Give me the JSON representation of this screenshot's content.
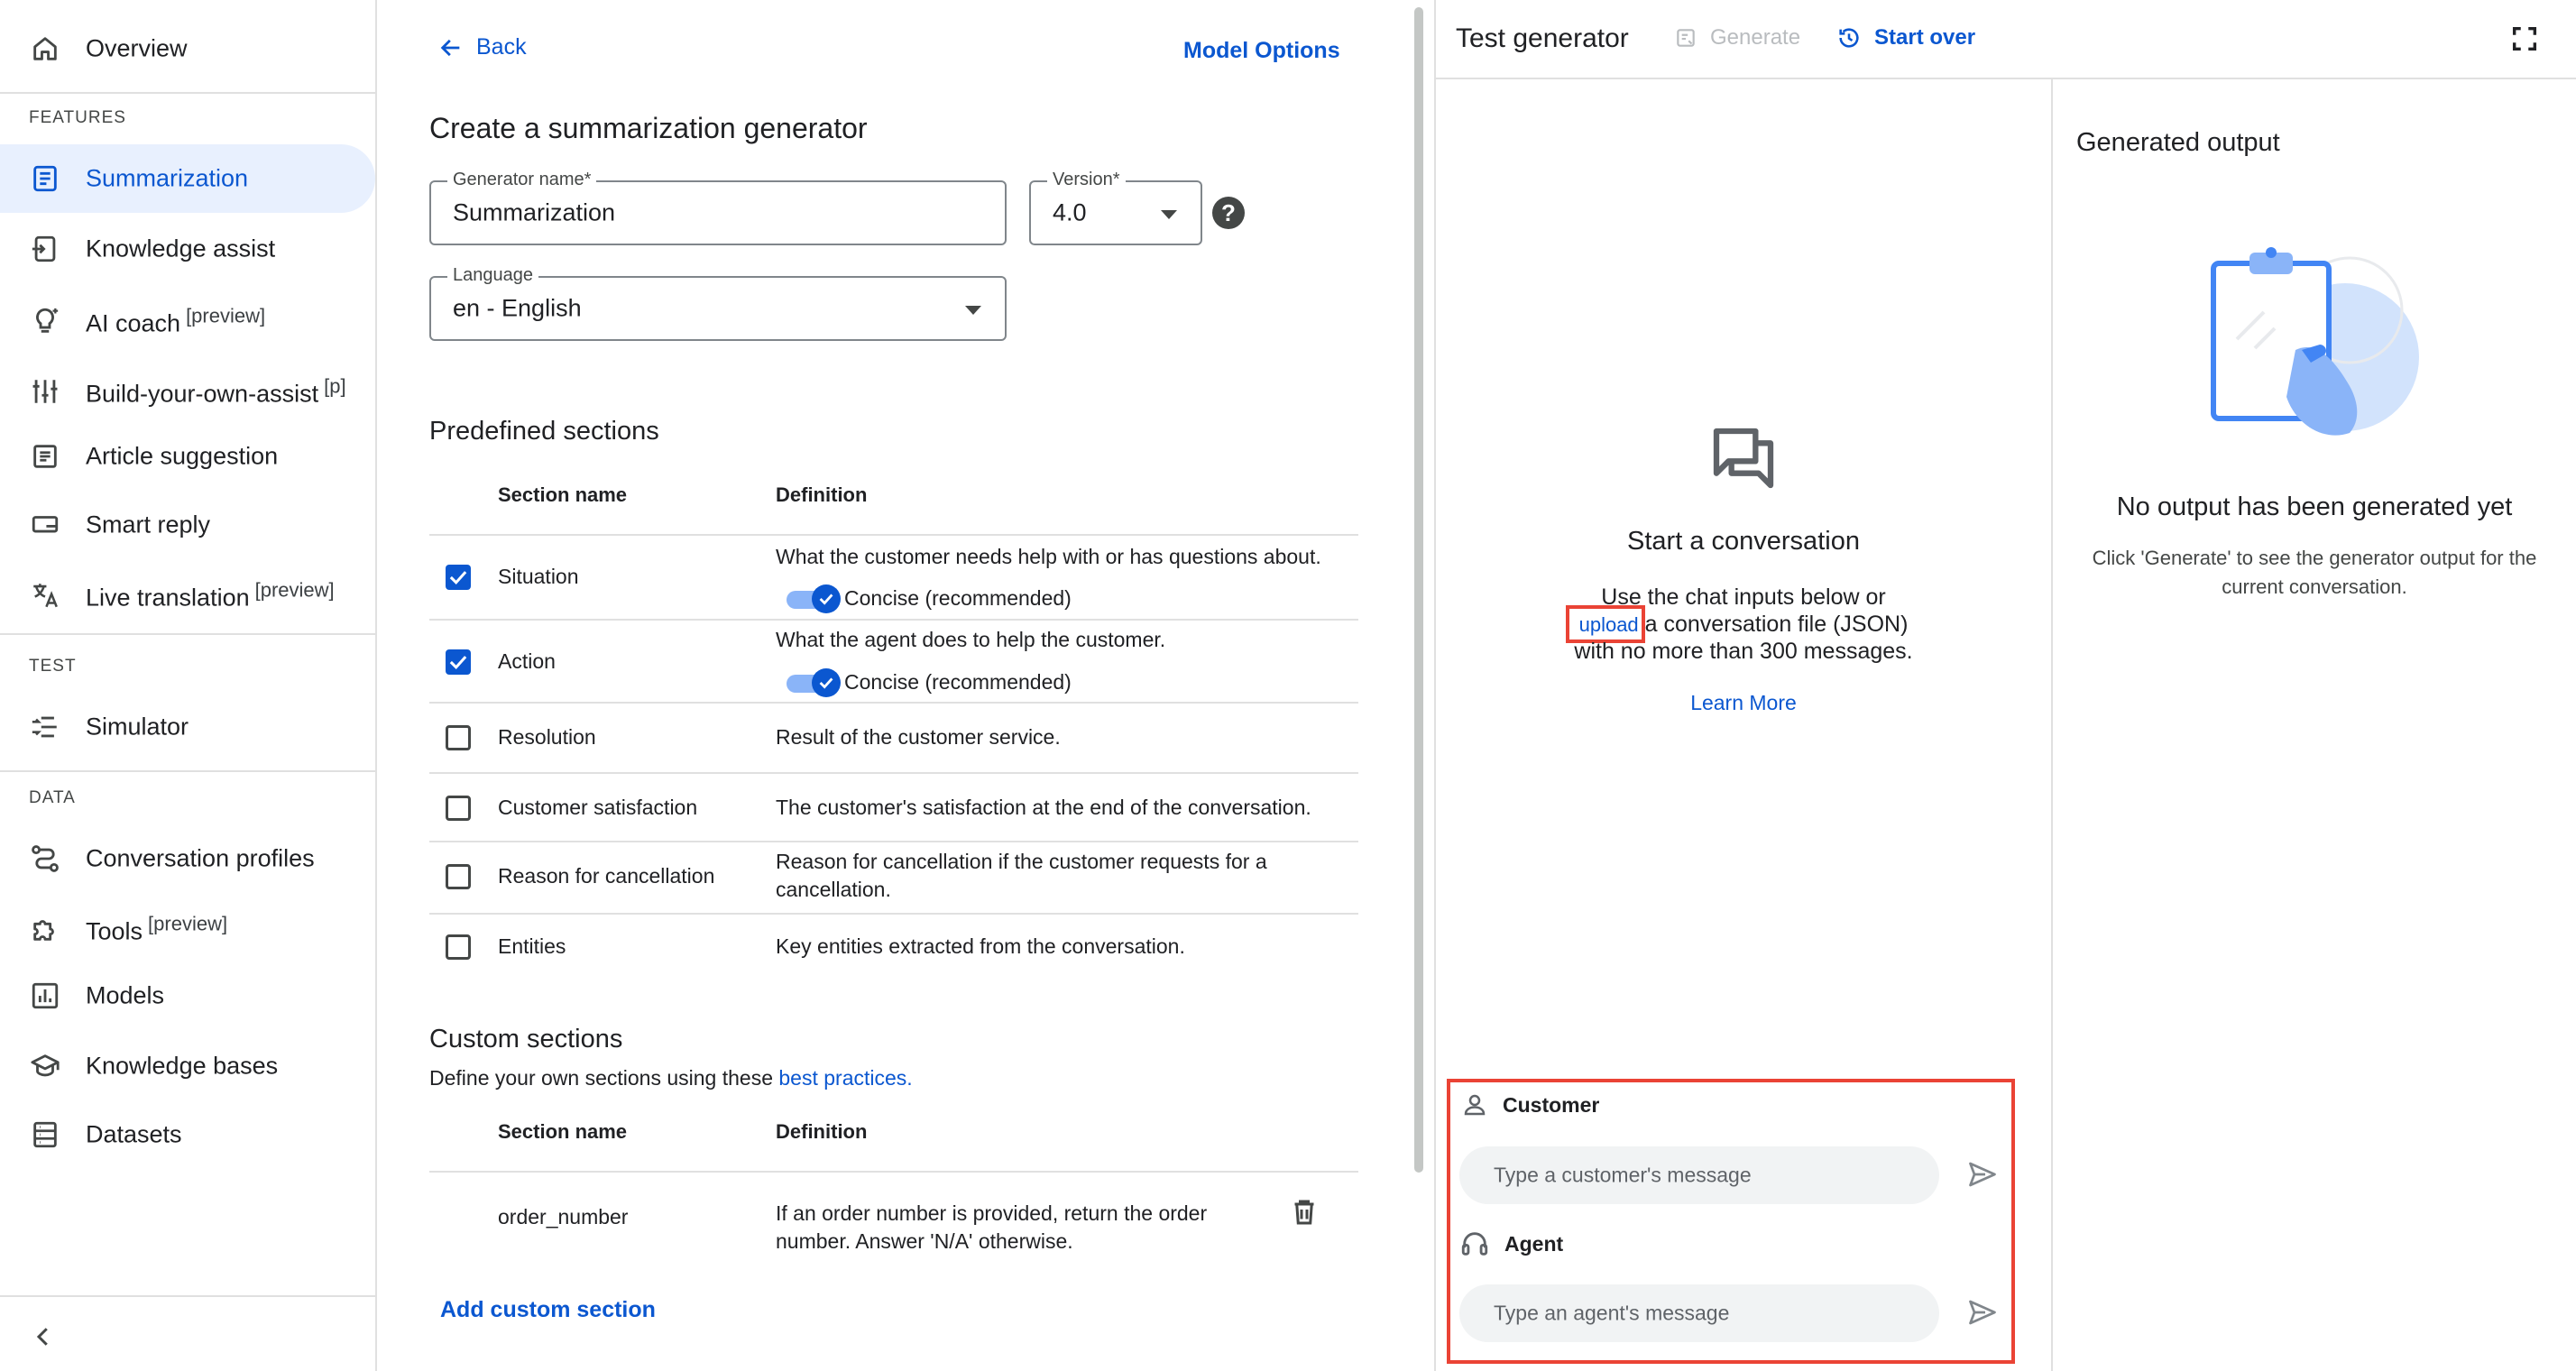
{
  "sidebar": {
    "overview": "Overview",
    "features_head": "FEATURES",
    "items": [
      {
        "label": "Summarization",
        "tag": ""
      },
      {
        "label": "Knowledge assist",
        "tag": ""
      },
      {
        "label": "AI coach",
        "tag": "[preview]"
      },
      {
        "label": "Build-your-own-assist",
        "tag": "[p]"
      },
      {
        "label": "Article suggestion",
        "tag": ""
      },
      {
        "label": "Smart reply",
        "tag": ""
      },
      {
        "label": "Live translation",
        "tag": "[preview]"
      }
    ],
    "test_head": "TEST",
    "simulator": "Simulator",
    "data_head": "DATA",
    "data_items": [
      {
        "label": "Conversation profiles",
        "tag": ""
      },
      {
        "label": "Tools",
        "tag": "[preview]"
      },
      {
        "label": "Models",
        "tag": ""
      },
      {
        "label": "Knowledge bases",
        "tag": ""
      },
      {
        "label": "Datasets",
        "tag": ""
      }
    ]
  },
  "editor": {
    "back": "Back",
    "model_options": "Model Options",
    "title": "Create a summarization generator",
    "generator_name_label": "Generator name*",
    "generator_name_value": "Summarization",
    "version_label": "Version*",
    "version_value": "4.0",
    "language_label": "Language",
    "language_value": "en - English",
    "predefined_title": "Predefined sections",
    "col_section": "Section name",
    "col_definition": "Definition",
    "sections": [
      {
        "name": "Situation",
        "checked": true,
        "definition": "What the customer needs help with or has questions about.",
        "toggle": "Concise (recommended)"
      },
      {
        "name": "Action",
        "checked": true,
        "definition": "What the agent does to help the customer.",
        "toggle": "Concise (recommended)"
      },
      {
        "name": "Resolution",
        "checked": false,
        "definition": "Result of the customer service."
      },
      {
        "name": "Customer satisfaction",
        "checked": false,
        "definition": "The customer's satisfaction at the end of the conversation."
      },
      {
        "name": "Reason for cancellation",
        "checked": false,
        "definition_line1": "Reason for cancellation if the customer requests for a",
        "definition_line2": "cancellation."
      },
      {
        "name": "Entities",
        "checked": false,
        "definition": "Key entities extracted from the conversation."
      }
    ],
    "custom_title": "Custom sections",
    "custom_desc": "Define your own sections using these",
    "custom_link": "best practices.",
    "custom_rows": [
      {
        "name": "order_number",
        "definition_line1": "If an order number is provided, return the order",
        "definition_line2": "number. Answer 'N/A' otherwise."
      }
    ],
    "add_custom": "Add custom section"
  },
  "test": {
    "title": "Test generator",
    "generate": "Generate",
    "start_over": "Start over",
    "start_title": "Start a conversation",
    "start_line1": "Use the chat inputs below or",
    "upload": "upload",
    "start_line2_rest": "a conversation file (JSON)",
    "start_line3": "with no more than 300 messages.",
    "learn_more": "Learn More",
    "customer_label": "Customer",
    "customer_placeholder": "Type a customer's message",
    "agent_label": "Agent",
    "agent_placeholder": "Type an agent's message",
    "output_title": "Generated output",
    "no_output": "No output has been generated yet",
    "no_output_desc1": "Click 'Generate' to see the generator output for the",
    "no_output_desc2": "current conversation."
  },
  "colors": {
    "accent": "#0b57d0",
    "highlight": "#ea4335",
    "active_bg": "#e8f0fe"
  }
}
